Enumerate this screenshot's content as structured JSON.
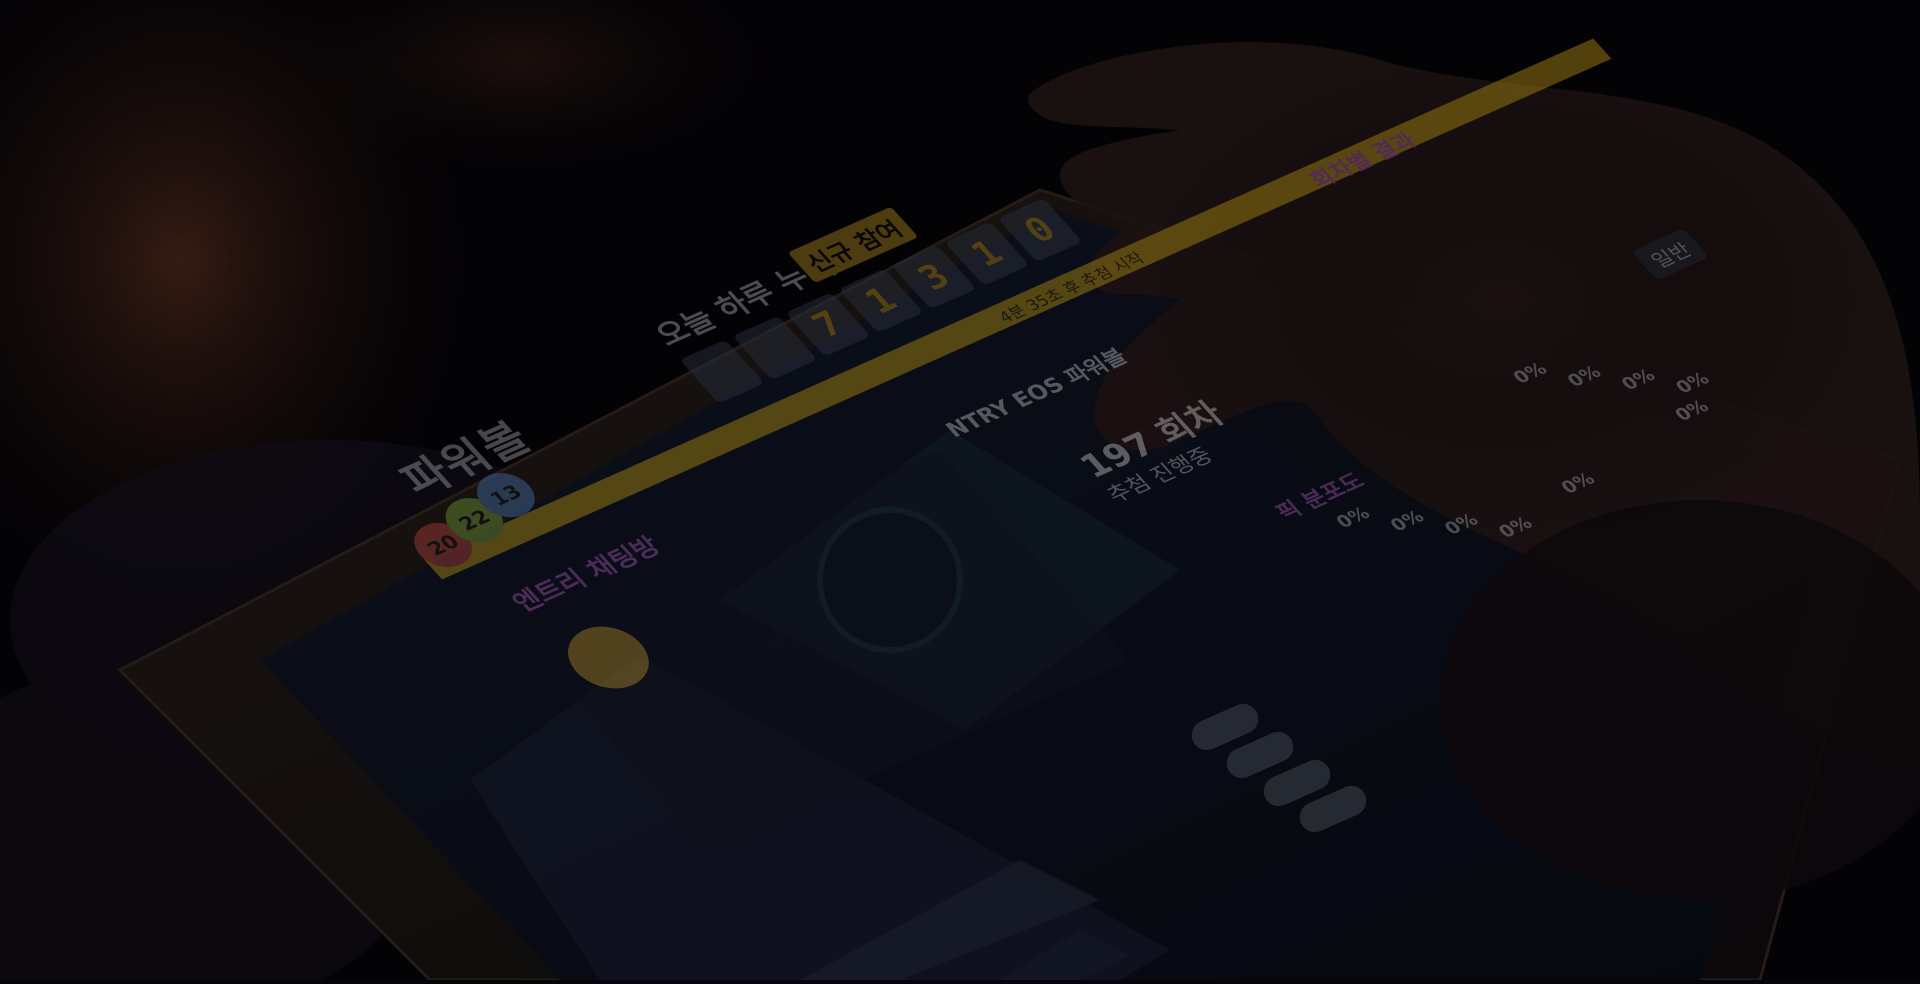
{
  "screen": {
    "game_title": "파워볼",
    "counter_label": "오늘 하루 누적",
    "counter_badge": "신규 참여",
    "counter_digits": [
      "",
      "",
      "7",
      "1",
      "3",
      "1",
      "0"
    ],
    "timer_text": "4분 35초 후 추첨 시작",
    "chat_title": "엔트리 채팅방",
    "history_title": "회차별 결과",
    "pick_title": "픽 분포도",
    "live_game_title": "NTRY EOS 파워볼",
    "round_text": "197 회차",
    "round_sub": "추첨 진행중",
    "balls": [
      "20",
      "22",
      "13"
    ],
    "percentages": [
      "0%",
      "0%",
      "0%",
      "0%",
      "0%",
      "0%",
      "0%",
      "0%",
      "0%",
      "0%"
    ],
    "side_badge": "일반"
  },
  "colors": {
    "accent_yellow": "#e1b51d",
    "accent_purple": "#c768d8",
    "digit_gold": "#d9a31f",
    "background": "#050409"
  }
}
